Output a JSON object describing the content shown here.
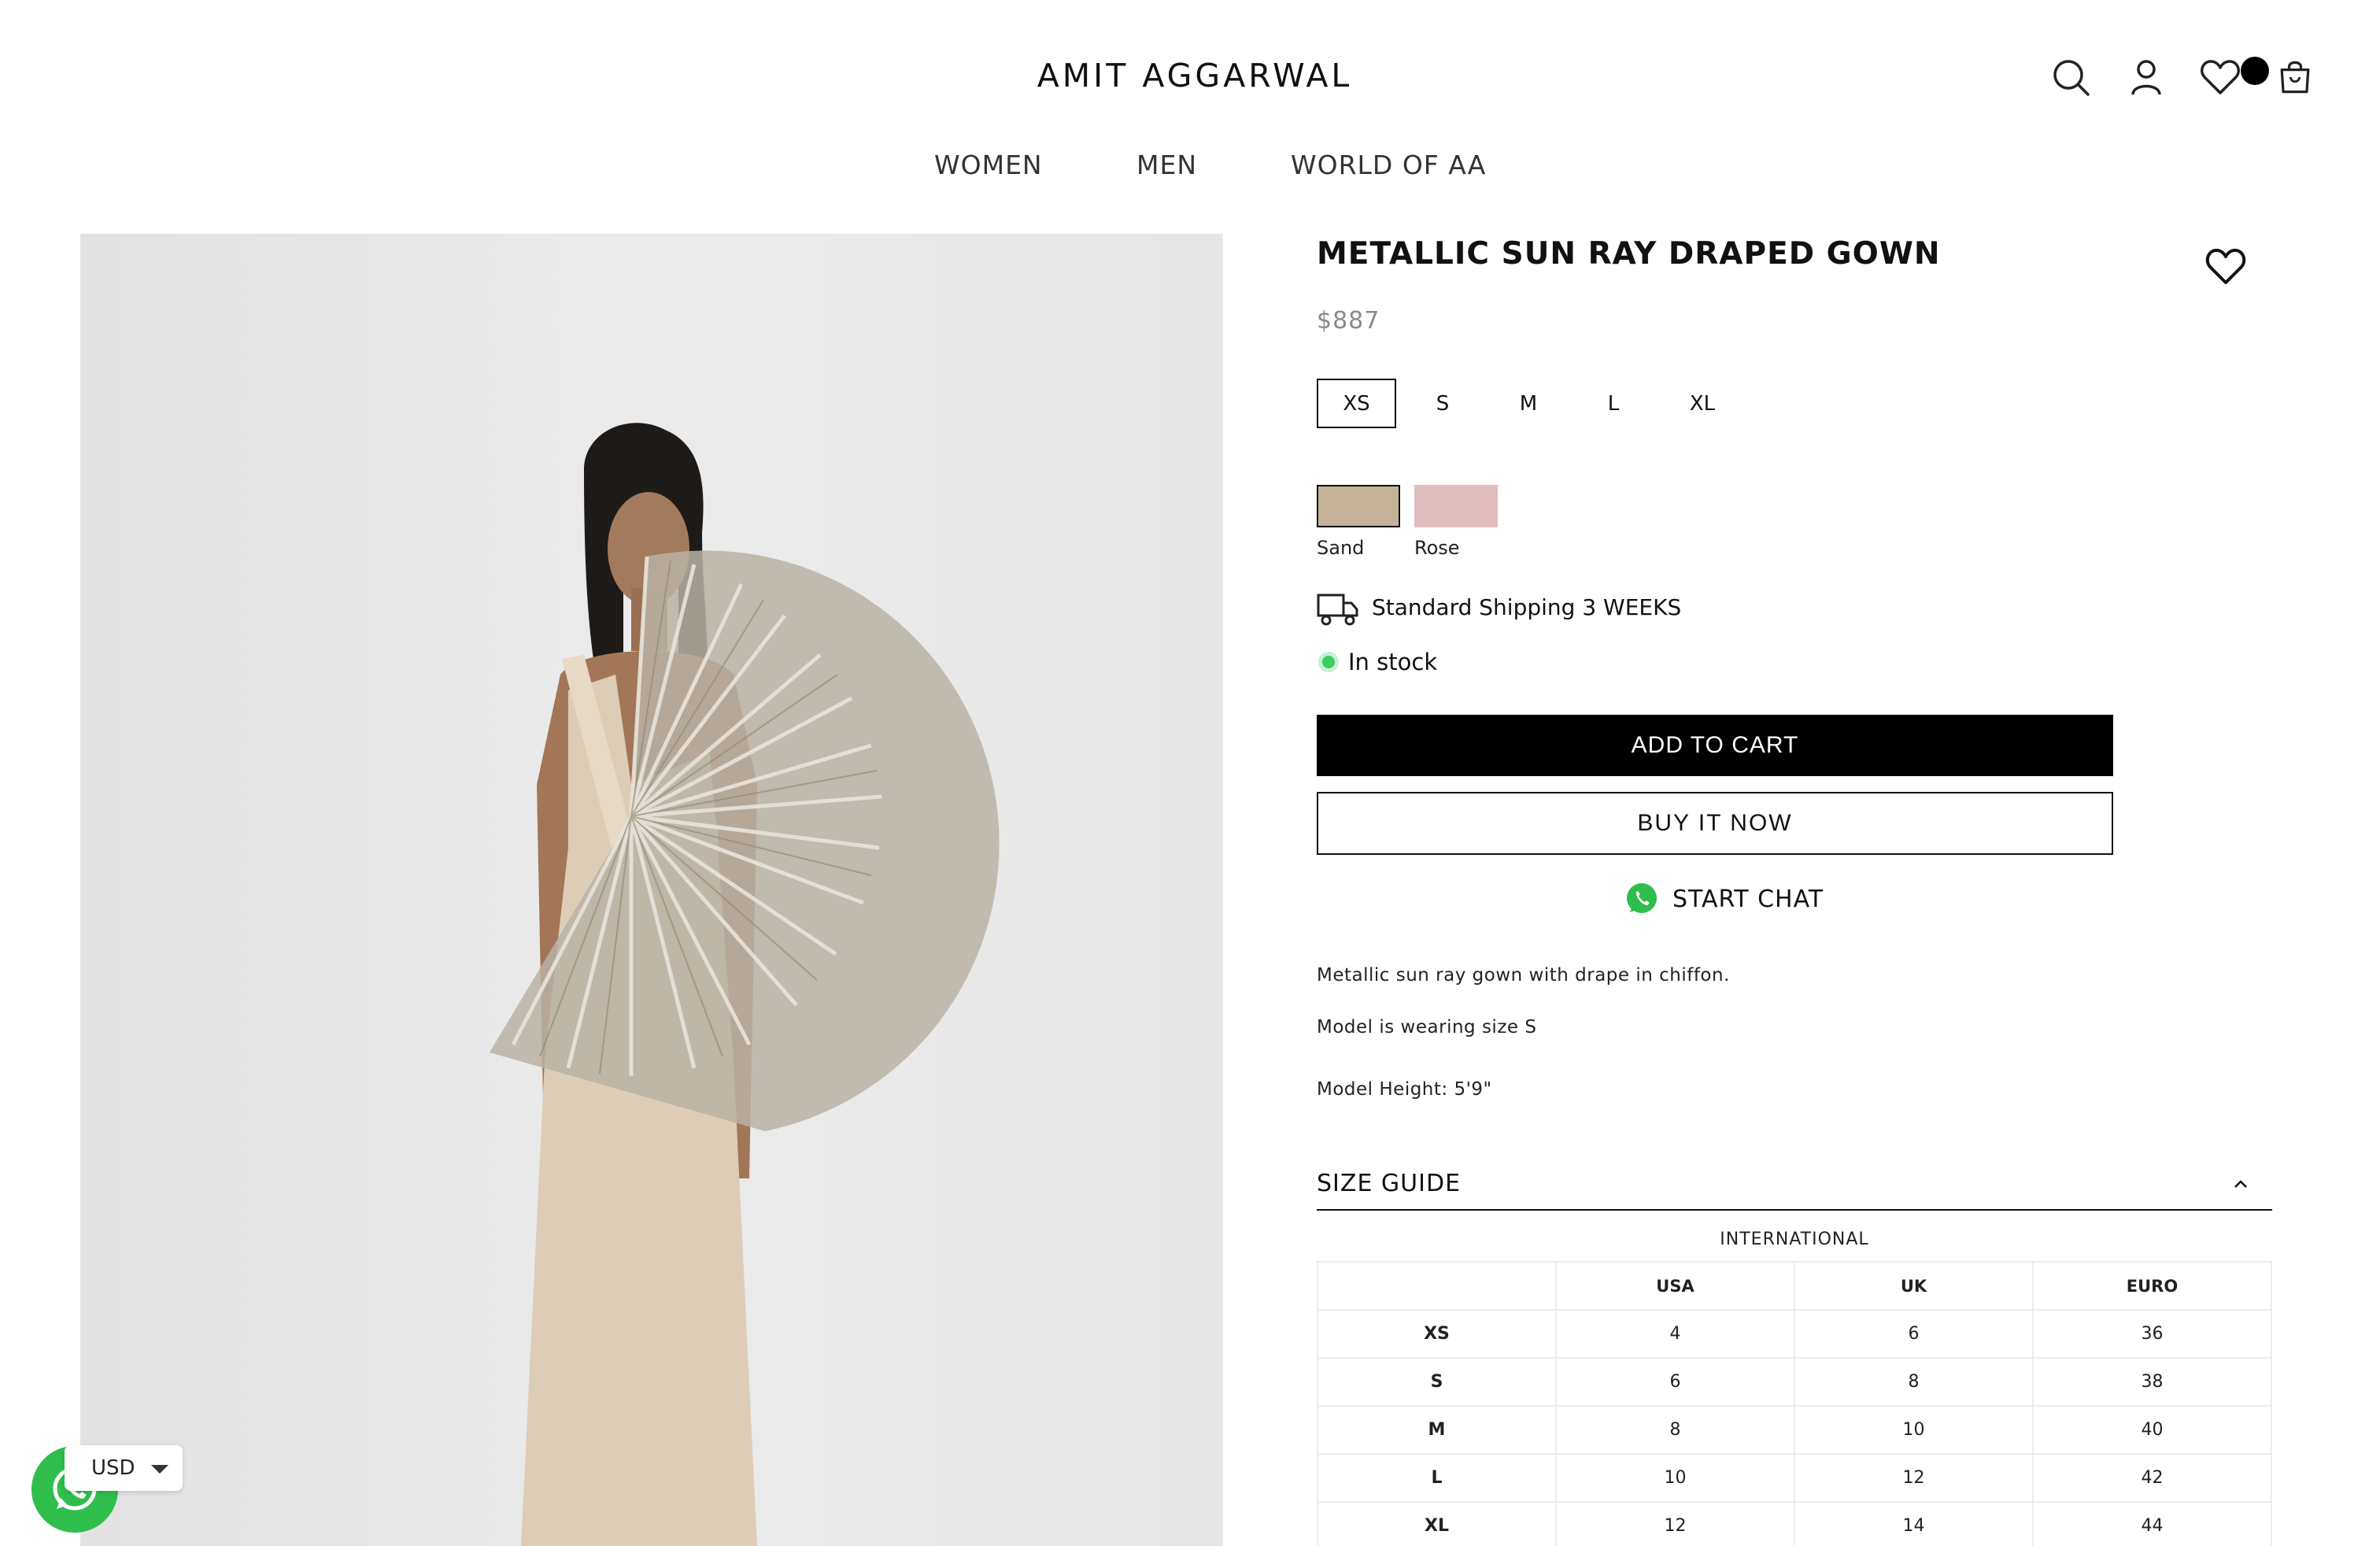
{
  "header": {
    "logo": "AMIT AGGARWAL",
    "icons": [
      "search-icon",
      "account-icon",
      "wishlist-icon",
      "cart-icon"
    ],
    "wishlist_badge_color": "#000000"
  },
  "nav": {
    "items": [
      {
        "label": "WOMEN"
      },
      {
        "label": "MEN"
      },
      {
        "label": "WORLD OF AA"
      }
    ]
  },
  "product": {
    "title": "METALLIC SUN RAY DRAPED GOWN",
    "price": "$887",
    "sizes": [
      {
        "label": "XS",
        "selected": true
      },
      {
        "label": "S",
        "selected": false
      },
      {
        "label": "M",
        "selected": false
      },
      {
        "label": "L",
        "selected": false
      },
      {
        "label": "XL",
        "selected": false
      }
    ],
    "colors": [
      {
        "label": "Sand",
        "hex": "#c4b397",
        "selected": true
      },
      {
        "label": "Rose",
        "hex": "#e0bcbf",
        "selected": false
      }
    ],
    "shipping": "Standard Shipping 3 WEEKS",
    "stock": "In stock",
    "stock_color": "#3ccd5a",
    "add_to_cart": "ADD TO CART",
    "buy_now": "BUY IT NOW",
    "chat": "START CHAT",
    "description": [
      "Metallic sun ray gown with drape in chiffon.",
      "Model is wearing size S",
      "Model Height: 5'9\""
    ]
  },
  "size_guide": {
    "title": "SIZE GUIDE",
    "subtitle": "INTERNATIONAL",
    "columns": [
      "",
      "USA",
      "UK",
      "EURO"
    ],
    "rows": [
      [
        "XS",
        "4",
        "6",
        "36"
      ],
      [
        "S",
        "6",
        "8",
        "38"
      ],
      [
        "M",
        "8",
        "10",
        "40"
      ],
      [
        "L",
        "10",
        "12",
        "42"
      ],
      [
        "XL",
        "12",
        "14",
        "44"
      ]
    ]
  },
  "currency": {
    "selected": "USD"
  },
  "accent_whatsapp": "#2fbe4c"
}
